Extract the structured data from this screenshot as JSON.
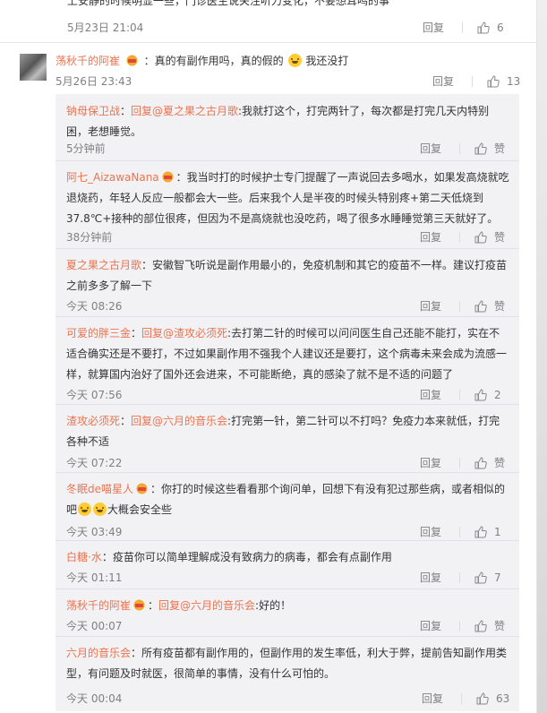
{
  "top_comment": {
    "text": "上安静的时候明显一些，门诊医生说关注听力变化，不要想耳鸣的事",
    "time": "5月23日 21:04",
    "reply_label": "回复",
    "likes": "6"
  },
  "main_comment": {
    "user": "荡秋千的阿崔",
    "text_a": "：真的有副作用吗，真的假的",
    "text_b": "我还没打",
    "time": "5月26日 23:43",
    "reply_label": "回复",
    "likes": "13"
  },
  "replies": [
    {
      "user": "钠母保卫战",
      "mention": "回复@夏之果之古月歌",
      "text": ":我就打这个，打完两针了，每次都是打完几天内特别困，老想睡觉。",
      "time": "5分钟前",
      "reply_label": "回复",
      "likes": "赞"
    },
    {
      "user": "阿七_AizawaNana",
      "mention": "",
      "text": "：我当时打的时候护士专门提醒了一声说回去多喝水，如果发高烧就吃退烧药，年轻人反应一般都会大一些。后来我个人是半夜的时候头特别疼+第二天低烧到37.8℃+接种的部位很疼，但因为不是高烧就也没吃药，喝了很多水睡睡觉第三天就好了。",
      "time": "38分钟前",
      "reply_label": "回复",
      "likes": "赞"
    },
    {
      "user": "夏之果之古月歌",
      "mention": "",
      "text": "：安徽智飞听说是副作用最小的，免疫机制和其它的疫苗不一样。建议打疫苗之前多多了解一下",
      "time": "今天 08:26",
      "reply_label": "回复",
      "likes": "赞"
    },
    {
      "user": "可爱的胖三金",
      "mention": "回复@渣攻必须死",
      "text": ":去打第二针的时候可以问问医生自己还能不能打，实在不适合确实还是不要打，不过如果副作用不强我个人建议还是要打，这个病毒未来会成为流感一样，就算国内治好了国外还会进来，不可能断绝，真的感染了就不是不适的问题了",
      "time": "今天 07:56",
      "reply_label": "回复",
      "likes": "2"
    },
    {
      "user": "渣攻必须死",
      "mention": "回复@六月的音乐会",
      "text": ":打完第一针，第二针可以不打吗？免疫力本来就低，打完各种不适",
      "time": "今天 07:22",
      "reply_label": "回复",
      "likes": "赞"
    },
    {
      "user": "冬眠de喵星人",
      "mention": "",
      "text": "：你打的时候这些看看那个询问单，回想下有没有犯过那些病，或者相似的吧",
      "text_b": "大概会安全些",
      "time": "今天 03:49",
      "reply_label": "回复",
      "likes": "1"
    },
    {
      "user": "白糖·水",
      "mention": "",
      "text": "：疫苗你可以简单理解成没有致病力的病毒，都会有点副作用",
      "time": "今天 01:11",
      "reply_label": "回复",
      "likes": "7"
    },
    {
      "user": "荡秋千的阿崔",
      "mention": "回复@六月的音乐会",
      "text": ":好的！",
      "time": "今天 00:07",
      "reply_label": "回复",
      "likes": "赞"
    },
    {
      "user": "六月的音乐会",
      "mention": "",
      "text": "：所有疫苗都有副作用的，但副作用的发生率低，利大于弊，提前告知副作用类型，有问题及时就医，很简单的事情，没有什么可怕的。",
      "time": "今天 00:04",
      "reply_label": "回复",
      "likes": "63"
    }
  ]
}
